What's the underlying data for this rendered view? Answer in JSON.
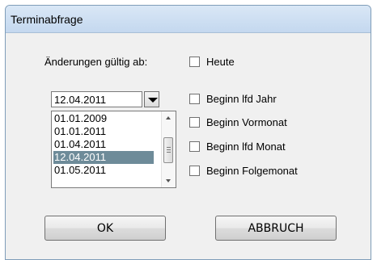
{
  "window": {
    "title": "Terminabfrage"
  },
  "form": {
    "valid_from_label": "Änderungen gültig ab:",
    "date_combo": {
      "value": "12.04.2011"
    },
    "date_list": {
      "items": [
        "01.01.2009",
        "01.01.2011",
        "01.04.2011",
        "12.04.2011",
        "01.05.2011"
      ],
      "selected": "12.04.2011"
    },
    "options": [
      {
        "label": "Heute",
        "checked": false
      },
      {
        "label": "Beginn lfd Jahr",
        "checked": false
      },
      {
        "label": "Beginn Vormonat",
        "checked": false
      },
      {
        "label": "Beginn lfd Monat",
        "checked": false
      },
      {
        "label": "Beginn Folgemonat",
        "checked": false
      }
    ]
  },
  "buttons": {
    "ok": "OK",
    "cancel": "ABBRUCH"
  }
}
